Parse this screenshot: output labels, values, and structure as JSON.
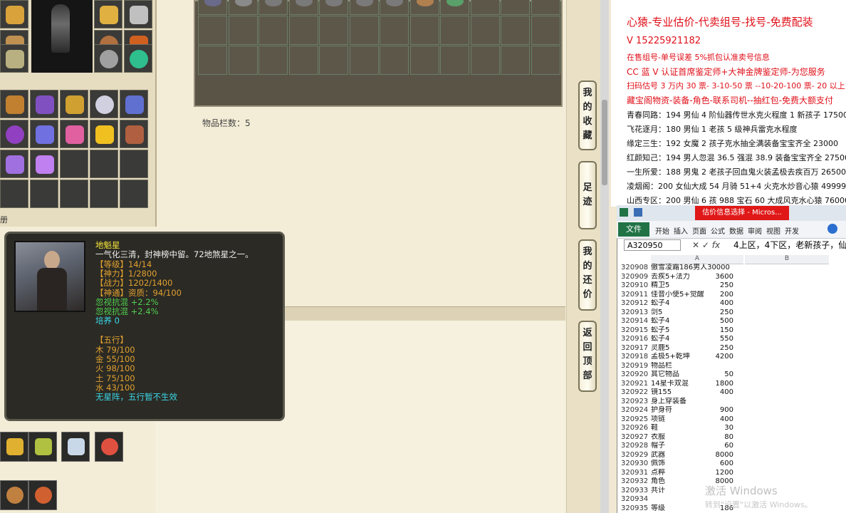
{
  "game": {
    "inventory_count_label": "物品栏数：5",
    "side_label_left": "册",
    "tabs": [
      {
        "label": "我的收藏"
      },
      {
        "label": "足迹"
      },
      {
        "label": "我的还价"
      },
      {
        "label": "返回顶部"
      }
    ],
    "tooltip": {
      "name": "地魁星",
      "desc": "一气化三清，封神榜中留。72地煞星之一。",
      "level": "【等级】14/14",
      "shenli": "【神力】1/2800",
      "zhanli": "【战力】1202/1400",
      "shentong": "【神通】资质：94/100",
      "attr1": "忽视抗混 +2.2%",
      "attr2": "忽视抗混 +2.4%",
      "peiyang": "培养 0",
      "wuxing_title": "【五行】",
      "wuxing": [
        "木 79/100",
        "金 55/100",
        "火 98/100",
        "土 75/100",
        "水 43/100"
      ],
      "note": "无星阵，五行暂不生效"
    }
  },
  "seller": {
    "title": "心猿-专业估价-代卖组号-找号-免费配装",
    "contact": "V 15225921182",
    "lines_red": [
      "在售组号-单号误差 5%抓包认准卖号信息",
      "CC 蓝 V 认证首席鉴定师+大神金牌鉴定师-为您服务",
      "扫码估号 3 万内 30 票- 3-10-50 票 --10-20-100 票- 20 以上 150",
      "藏宝阁物资-装备-角色-联系司机--抽红包-免费大额支付"
    ],
    "listings": [
      "青春同路：194 男仙 4 阶仙器传世水克火程度 1 新孩子 17500",
      "飞花逐月：180 男仙 1 老孩 5 级神兵雷克水程度",
      "缘定三生：192 女魔 2 孩子克水抽全满装备宝宝齐全 23000",
      "红颜知己：194 男人忽混 36.5 强混 38.9 装备宝宝齐全 27500",
      "一生所爱：188 男鬼 2 老孩子回血鬼火装孟极去疾百万 26500",
      "凌烟阁：200 女仙大成 54 月骑 51+4 火克水炒音心猿 49999",
      "山西专区：200 男仙 6 孩 988 宝石 60 大成风克水心猿 76000"
    ]
  },
  "excel": {
    "title_tab": "估价信息选择 - Micros...",
    "file_tab": "文件",
    "ribbon": [
      "开始",
      "插入",
      "页面",
      "公式",
      "数据",
      "审阅",
      "视图",
      "开发"
    ],
    "name_box": "A320950",
    "formula": "4上区，4下区，老新孩子，仙",
    "col_a": "A",
    "col_b": "B",
    "rows": [
      {
        "n": "320908",
        "a": "傲雪凌霜186男人30000",
        "b": ""
      },
      {
        "n": "320909",
        "a": "去疾5+法力",
        "b": "3600"
      },
      {
        "n": "320910",
        "a": "精卫5",
        "b": "250"
      },
      {
        "n": "320911",
        "a": "佳音小使5+觉醒",
        "b": "200"
      },
      {
        "n": "320912",
        "a": "蚣子4",
        "b": "400"
      },
      {
        "n": "320913",
        "a": "剑5",
        "b": "250"
      },
      {
        "n": "320914",
        "a": "蚣子4",
        "b": "500"
      },
      {
        "n": "320915",
        "a": "蚣子5",
        "b": "150"
      },
      {
        "n": "320916",
        "a": "蚣子4",
        "b": "550"
      },
      {
        "n": "320917",
        "a": "灵鹿5",
        "b": "250"
      },
      {
        "n": "320918",
        "a": "孟极5+乾坤",
        "b": "4200"
      },
      {
        "n": "320919",
        "a": "物品栏",
        "b": ""
      },
      {
        "n": "320920",
        "a": "其它物品",
        "b": "50"
      },
      {
        "n": "320921",
        "a": "14星卡双混",
        "b": "1800"
      },
      {
        "n": "320922",
        "a": "镜155",
        "b": "400"
      },
      {
        "n": "320923",
        "a": "身上穿装备",
        "b": ""
      },
      {
        "n": "320924",
        "a": "护身符",
        "b": "900"
      },
      {
        "n": "320925",
        "a": "项链",
        "b": "400"
      },
      {
        "n": "320926",
        "a": "鞋",
        "b": "30"
      },
      {
        "n": "320927",
        "a": "衣服",
        "b": "80"
      },
      {
        "n": "320928",
        "a": "帽子",
        "b": "60"
      },
      {
        "n": "320929",
        "a": "武器",
        "b": "8000"
      },
      {
        "n": "320930",
        "a": "佩饰",
        "b": "600"
      },
      {
        "n": "320931",
        "a": "点粹",
        "b": "1200"
      },
      {
        "n": "320932",
        "a": "角色",
        "b": "8000"
      },
      {
        "n": "320933",
        "a": "共计",
        "b": ""
      },
      {
        "n": "320934",
        "a": "",
        "b": ""
      },
      {
        "n": "320935",
        "a": "等级",
        "b": "186"
      }
    ],
    "watermark1": "激活 Windows",
    "watermark2": "转到\"设置\"以激活 Windows。"
  }
}
